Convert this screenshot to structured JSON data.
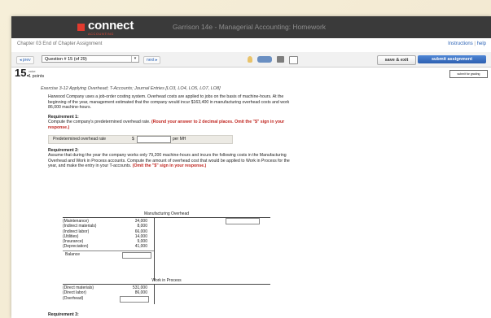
{
  "app": {
    "logo_text": "connect",
    "logo_sub": "ACCOUNTING",
    "title": "Garrison 14e - Managerial Accounting: Homework"
  },
  "subbar": {
    "chapter": "Chapter 03 End of Chapter Assignment",
    "instructions_link": "Instructions",
    "help_link": "help",
    "separator": "|"
  },
  "toolbar": {
    "prev_label": "◂ prev",
    "question_select": "Question # 15 (of 29)",
    "next_label": "next ▸",
    "save_exit": "save & exit",
    "submit": "submit assignment"
  },
  "question": {
    "number": "15.",
    "value_label": "value:",
    "points": "1 points",
    "grading_button": "submit for grading",
    "exercise_title": "Exercise 3-12 Applying Overhead; T-Accounts; Journal Entries [LO3, LO4, LO5, LO7, LO8]",
    "intro": "Harwood Company uses a job-order costing system. Overhead costs are applied to jobs on the basis of machine-hours. At the beginning of the year, management estimated that the company would incur $163,400 in manufacturing overhead costs and work 86,000 machine-hours.",
    "req1_title": "Requirement 1:",
    "req1_text": "Compute the company's predetermined overhead rate.",
    "req1_red": "(Round your answer to 2 decimal places. Omit the \"$\" sign in your response.)",
    "rate_label": "Predetermined overhead rate",
    "rate_dollar": "$",
    "rate_unit": "per MH",
    "req2_title": "Requirement 2:",
    "req2_text": "Assume that during the year the company works only 79,200 machine-hours and incurs the following costs in the Manufacturing Overhead and Work in Process accounts. Compute the amount of overhead cost that would be applied to Work in Process for the year, and make the entry in your T-accounts.",
    "req2_red": "(Omit the \"$\" sign in your response.)",
    "req3_title": "Requirement 3:"
  },
  "mfg_overhead": {
    "title": "Manufacturing Overhead",
    "rows": [
      {
        "label": "(Maintenance)",
        "value": "34,000"
      },
      {
        "label": "(Indirect materials)",
        "value": "8,000"
      },
      {
        "label": "(Indirect labor)",
        "value": "66,000"
      },
      {
        "label": "(Utilities)",
        "value": "14,000"
      },
      {
        "label": "(Insurance)",
        "value": "9,000"
      },
      {
        "label": "(Depreciation)",
        "value": "41,000"
      }
    ],
    "balance_label": "Balance"
  },
  "wip": {
    "title": "Work in Process",
    "rows": [
      {
        "label": "(Direct materials)",
        "value": "531,000"
      },
      {
        "label": "(Direct labor)",
        "value": "86,000"
      },
      {
        "label": "(Overhead)",
        "value": ""
      }
    ]
  }
}
